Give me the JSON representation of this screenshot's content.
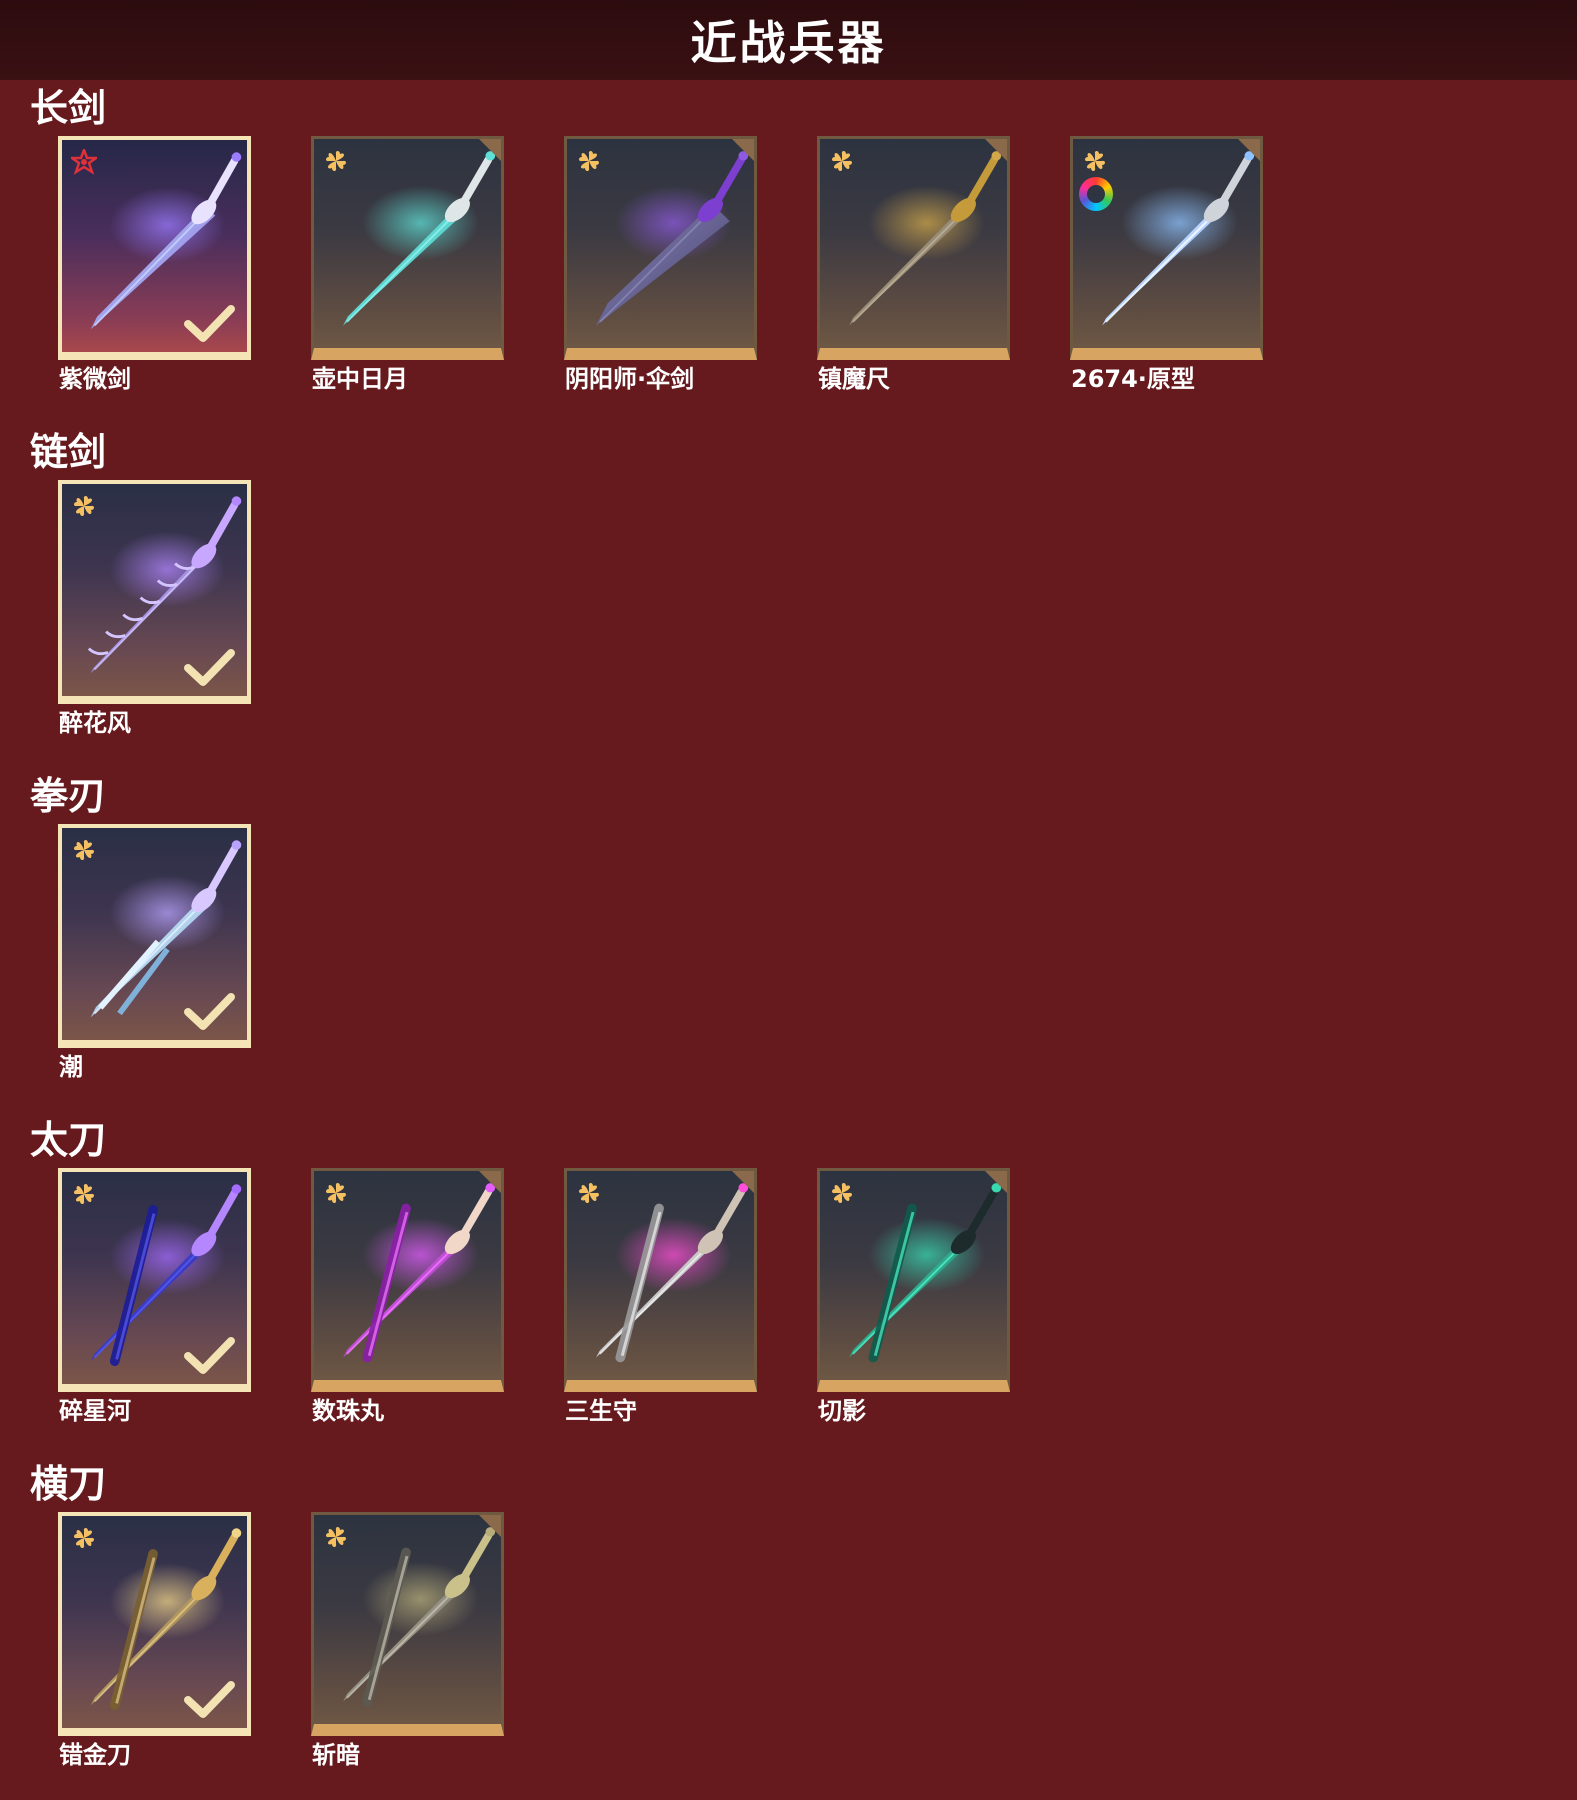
{
  "header": {
    "title": "近战兵器"
  },
  "sections": [
    {
      "title": "长剑",
      "items": [
        {
          "name": "紫微剑",
          "owned": true,
          "badge": "red-star-icon",
          "art": "crystal-sword"
        },
        {
          "name": "壶中日月",
          "owned": false,
          "badge": "gold-flower-icon",
          "art": "jade-sword"
        },
        {
          "name": "阴阳师·伞剑",
          "owned": false,
          "badge": "gold-flower-icon",
          "art": "umbrella-sword"
        },
        {
          "name": "镇魔尺",
          "owned": false,
          "badge": "gold-flower-icon",
          "art": "bronze-sword"
        },
        {
          "name": "2674·原型",
          "owned": false,
          "badge": "gold-flower-icon",
          "extra_icon": "color-ring-icon",
          "art": "light-saber"
        }
      ]
    },
    {
      "title": "链剑",
      "items": [
        {
          "name": "醉花风",
          "owned": true,
          "badge": "gold-flower-icon",
          "art": "chain-sword"
        }
      ]
    },
    {
      "title": "拳刃",
      "items": [
        {
          "name": "潮",
          "owned": true,
          "badge": "gold-flower-icon",
          "art": "claw-blade"
        }
      ]
    },
    {
      "title": "太刀",
      "items": [
        {
          "name": "碎星河",
          "owned": true,
          "badge": "gold-flower-icon",
          "art": "blue-katana"
        },
        {
          "name": "数珠丸",
          "owned": false,
          "badge": "gold-flower-icon",
          "art": "pink-katana"
        },
        {
          "name": "三生守",
          "owned": false,
          "badge": "gold-flower-icon",
          "art": "white-katana"
        },
        {
          "name": "切影",
          "owned": false,
          "badge": "gold-flower-icon",
          "art": "green-katana"
        }
      ]
    },
    {
      "title": "横刀",
      "items": [
        {
          "name": "错金刀",
          "owned": true,
          "badge": "gold-flower-icon",
          "art": "gold-sabre"
        },
        {
          "name": "斩暗",
          "owned": false,
          "badge": "gold-flower-icon",
          "art": "dragon-sabre"
        }
      ]
    }
  ],
  "colors": {
    "background": "#661a1e",
    "header_background": "#300c0f",
    "tile_trim": "#d8a462",
    "owned_frame": "#f5e4b6",
    "badge_gold": "#f4c061",
    "badge_red": "#e0303a"
  }
}
